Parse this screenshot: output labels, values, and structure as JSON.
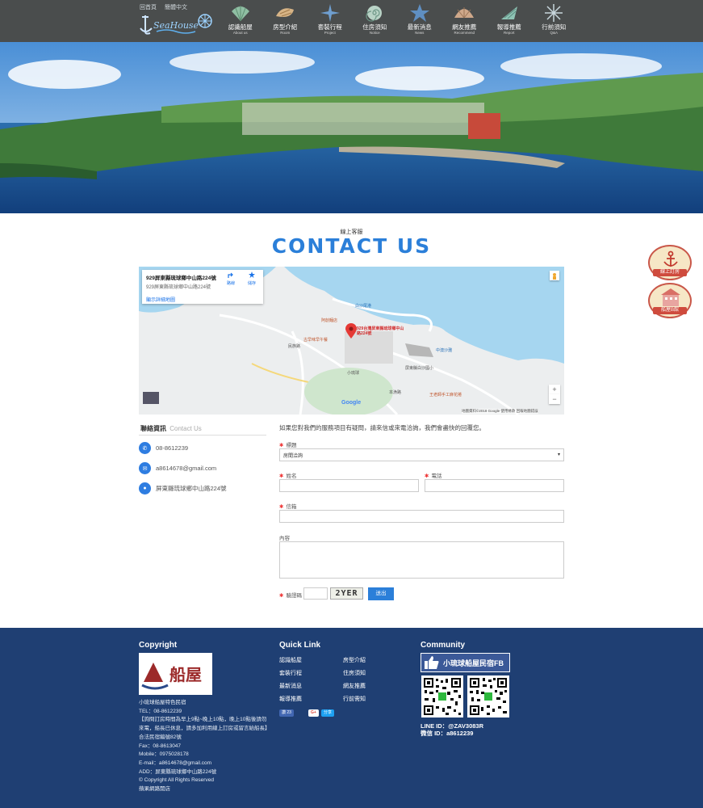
{
  "header": {
    "top_links": [
      "回首頁",
      "簡體中文"
    ],
    "logo_alt": "小琉球船屋",
    "nav": [
      {
        "label": "認識船屋",
        "sub": "About us",
        "icon": "shell-icon"
      },
      {
        "label": "房型介紹",
        "sub": "Room",
        "icon": "conch-icon"
      },
      {
        "label": "套裝行程",
        "sub": "Project",
        "icon": "starfish-icon"
      },
      {
        "label": "住房須知",
        "sub": "Notice",
        "icon": "snail-shell-icon"
      },
      {
        "label": "最新消息",
        "sub": "News",
        "icon": "starfish-icon"
      },
      {
        "label": "網友推薦",
        "sub": "Recommend",
        "icon": "clam-icon"
      },
      {
        "label": "報導推薦",
        "sub": "Report",
        "icon": "spiral-shell-icon"
      },
      {
        "label": "行前須知",
        "sub": "Q&A",
        "icon": "star-icon"
      }
    ]
  },
  "section": {
    "subtitle": "線上客服",
    "title": "CONTACT US"
  },
  "badges": [
    {
      "label": "線上訂房",
      "icon": "anchor-icon"
    },
    {
      "label": "船屋B館",
      "icon": "building-icon"
    }
  ],
  "map": {
    "card_title": "929屏東縣琉球鄉中山路224號",
    "card_address": "929屏東縣琉球鄉中山路224號",
    "card_link": "顯示詳細地圖",
    "directions": "路線",
    "save": "儲存",
    "marker_label": "929台灣屏東縣琉球鄉中山路224號",
    "places": [
      "白沙尾港",
      "阿創麵店",
      "古早味早午餐",
      "小琉球",
      "屏東縣白沙國小",
      "王老師手工麻花捲",
      "中澳沙灘",
      "民族路",
      "本漁路"
    ],
    "footer_text": "地圖資料©2018 Google   使用條款   回報地圖錯誤",
    "google": "Google"
  },
  "contact_info": {
    "title": "聯絡資訊",
    "title_en": "Contact Us",
    "phone": "08-8612239",
    "email": "a8614678@gmail.com",
    "address": "屏東縣琉球鄉中山路224號"
  },
  "form": {
    "intro": "如果您對我們的服務項目有疑問，請來信或來電洽詢，我們會盡快的回覆您。",
    "subject_label": "標題",
    "subject_value": "房間洽詢",
    "name_label": "姓名",
    "phone_label": "電話",
    "email_label": "信箱",
    "content_label": "內容",
    "captcha_label": "驗證碼",
    "captcha_value": "2YER",
    "submit": "送出"
  },
  "footer": {
    "copyright_title": "Copyright",
    "quicklink_title": "Quick Link",
    "community_title": "Community",
    "company_lines": [
      "小琉球船屋特色民宿",
      "TEL：08-8612239",
      "【詢問訂房時間為早上9點~晚上10點，晚上10點後請勿來電，船長已休息，請多加利用線上訂房或留言給船長】",
      "合法民宿編號82號",
      "Fax：08-8613047",
      "Mobile：0975028178",
      "E-mail：a8614678@gmail.com",
      "ADD：屏東縣琉球鄉中山路224號",
      "© Copyright All Rights Reserved",
      "蘋果網路開店"
    ],
    "quicklinks": [
      "認識船屋",
      "房型介紹",
      "套裝行程",
      "住房須知",
      "最新消息",
      "網友推薦",
      "報導推薦",
      "行前需知"
    ],
    "like_label": "讚 23",
    "gplus_label": "G+",
    "share_label": "分享",
    "fb_label": "小琉球船屋民宿FB",
    "line_id": "LINE ID：@ZAV3083R",
    "wechat_id": "微信 ID：a8612239"
  },
  "colors": {
    "accent": "#2b7fd9",
    "header_bg": "#4a4d4d",
    "footer_bg": "#1f3f73",
    "required": "#ee3333"
  }
}
